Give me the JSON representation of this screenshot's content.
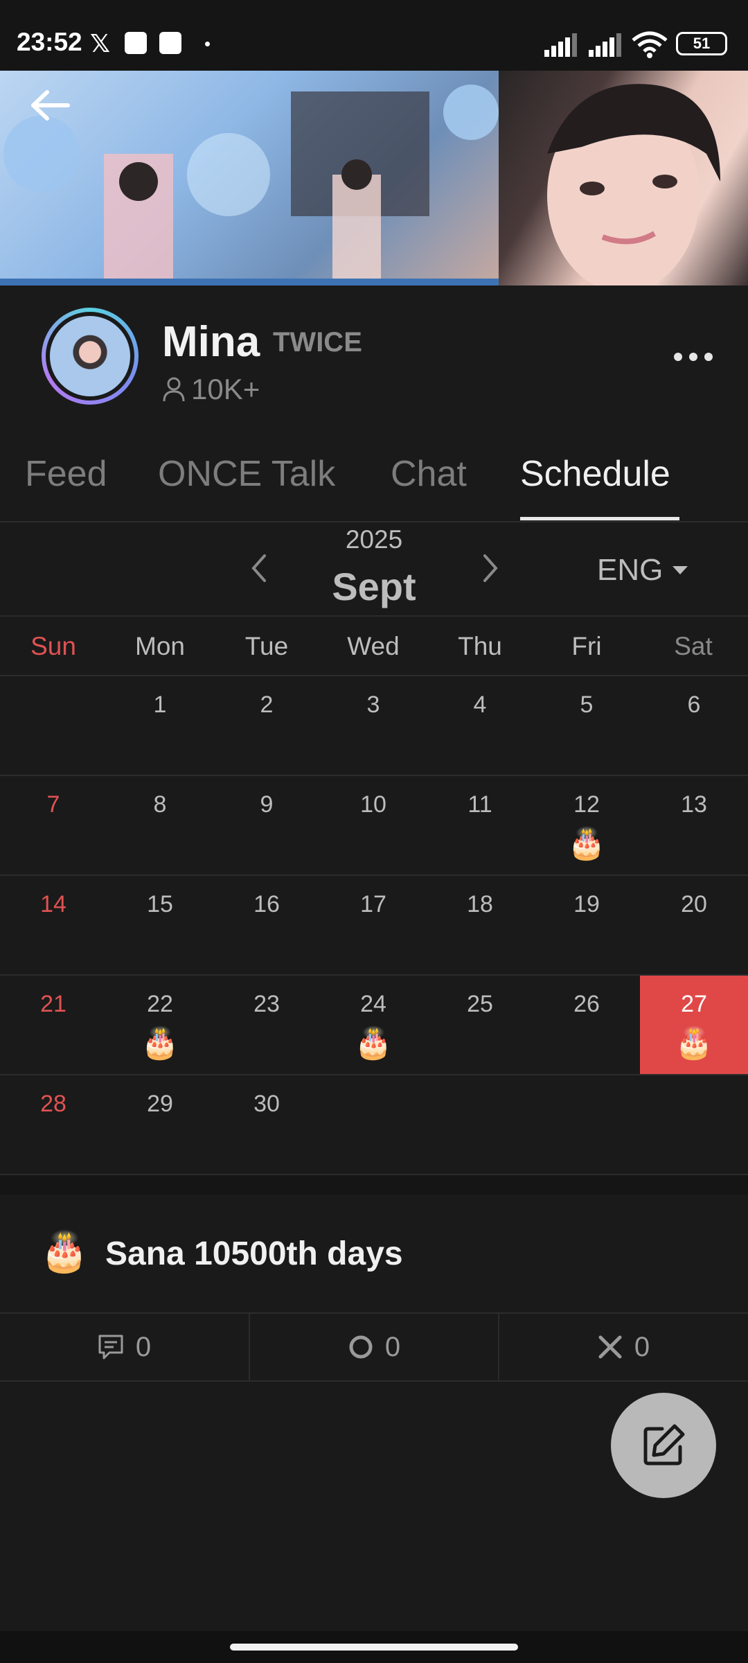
{
  "status_bar": {
    "time": "23:52",
    "x_glyph": "𝕏",
    "battery": "51"
  },
  "profile": {
    "name": "Mina",
    "group": "TWICE",
    "followers": "10K+"
  },
  "tabs": [
    {
      "label": "Feed",
      "active": false
    },
    {
      "label": "ONCE Talk",
      "active": false
    },
    {
      "label": "Chat",
      "active": false
    },
    {
      "label": "Schedule",
      "active": true
    }
  ],
  "calendar": {
    "year": "2025",
    "month": "Sept",
    "language": "ENG",
    "weekdays": [
      "Sun",
      "Mon",
      "Tue",
      "Wed",
      "Thu",
      "Fri",
      "Sat"
    ],
    "weeks": [
      [
        null,
        "1",
        "2",
        "3",
        "4",
        "5",
        "6"
      ],
      [
        "7",
        "8",
        "9",
        "10",
        "11",
        "12",
        "13"
      ],
      [
        "14",
        "15",
        "16",
        "17",
        "18",
        "19",
        "20"
      ],
      [
        "21",
        "22",
        "23",
        "24",
        "25",
        "26",
        "27"
      ],
      [
        "28",
        "29",
        "30",
        null,
        null,
        null,
        null
      ]
    ],
    "event_days": [
      "12",
      "22",
      "24",
      "27"
    ],
    "selected_day": "27",
    "event_icon": "🎂"
  },
  "event": {
    "icon": "🎂",
    "title": "Sana 10500th days",
    "comments": "0",
    "o_count": "0",
    "x_count": "0"
  },
  "colors": {
    "accent_red": "#e04848",
    "sunday_red": "#e05252",
    "background": "#1a1a1a"
  }
}
